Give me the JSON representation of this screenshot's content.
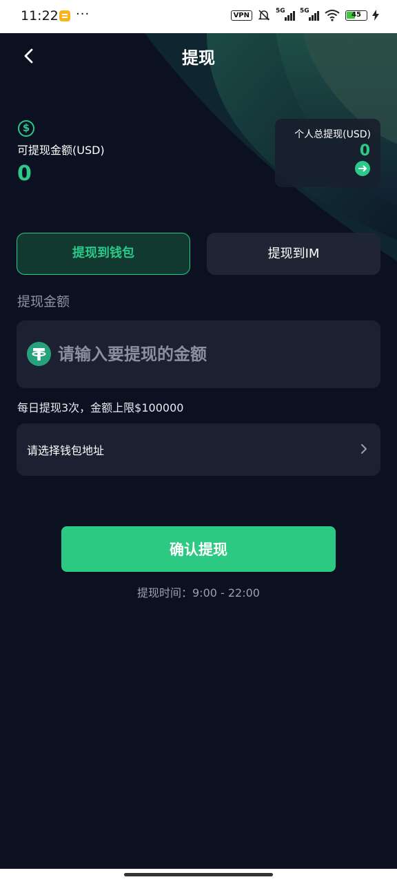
{
  "status_bar": {
    "time": "11:22",
    "more": "···",
    "vpn": "VPN",
    "sim1_network": "5G",
    "sim2_network": "5G",
    "battery": "45"
  },
  "header": {
    "title": "提现"
  },
  "balance": {
    "available_label": "可提现金额(USD)",
    "available_value": "0",
    "total_label": "个人总提现(USD)",
    "total_value": "0"
  },
  "tabs": [
    {
      "label": "提现到钱包",
      "active": true
    },
    {
      "label": "提现到IM",
      "active": false
    }
  ],
  "form": {
    "amount_label": "提现金额",
    "amount_placeholder": "请输入要提现的金额",
    "limit_text": "每日提现3次，金额上限$100000",
    "address_label": "请选择钱包地址"
  },
  "confirm_label": "确认提现",
  "time_text": "提现时间：9:00 - 22:00",
  "colors": {
    "accent": "#2bc981",
    "background": "#0b1120",
    "card": "#1b2130"
  }
}
